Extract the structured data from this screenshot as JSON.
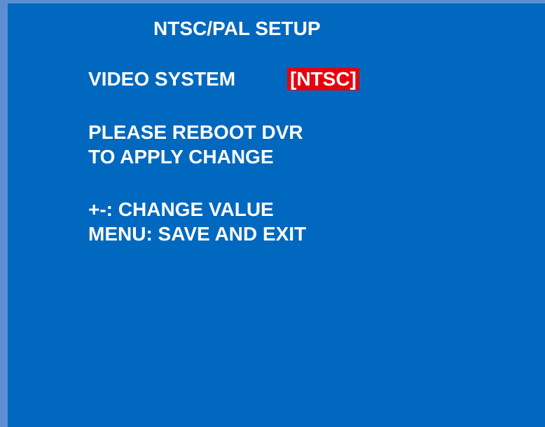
{
  "screen": {
    "title": "NTSC/PAL SETUP",
    "video_system": {
      "label": "VIDEO SYSTEM",
      "value": "[NTSC]"
    },
    "notice": {
      "line1": "PLEASE REBOOT DVR",
      "line2": "TO APPLY CHANGE"
    },
    "help": {
      "line1": "+-: CHANGE VALUE",
      "line2": "MENU: SAVE AND EXIT"
    }
  },
  "colors": {
    "background": "#0068be",
    "frame": "#5b8fd1",
    "highlight": "#e8000c",
    "text": "#ffffff"
  }
}
